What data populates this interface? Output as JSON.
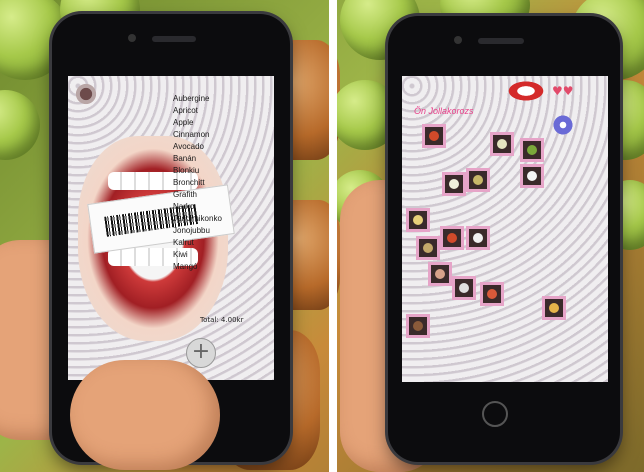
{
  "left_phone": {
    "fruits": [
      "Aubergine",
      "Apricot",
      "Apple",
      "Cinnamon",
      "Avocado",
      "Banán",
      "Blonkiu",
      "Bronchitt",
      "Grafith",
      "Narko",
      "Jeridimikonko",
      "Jonojubbu",
      "Kalrut",
      "Kiwi",
      "Mangó"
    ],
    "total_label": "Total: 4.00kr",
    "add_button_label": "+"
  },
  "right_phone": {
    "title": "Ön Jollakorozs"
  },
  "colors": {
    "accent_pink": "#e8418a",
    "tile_border": "#e6a4c8"
  }
}
